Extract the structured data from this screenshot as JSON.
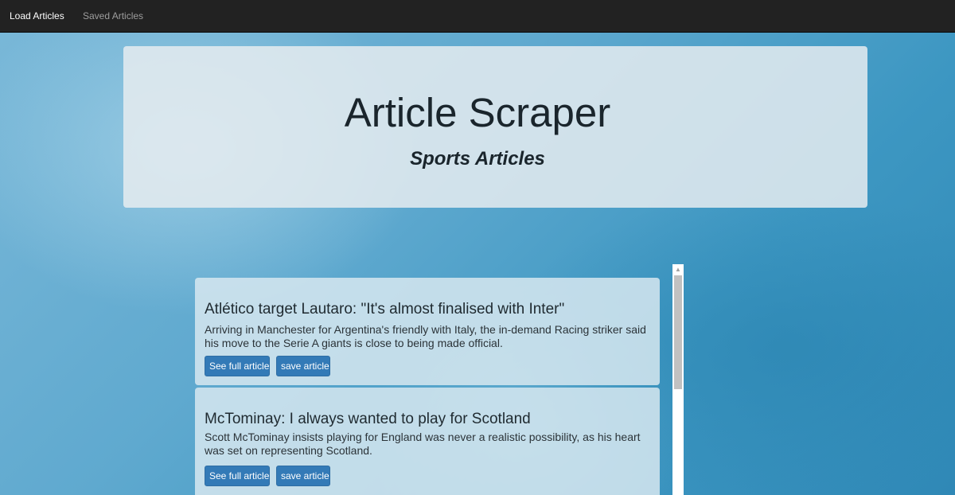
{
  "nav": {
    "load_articles": "Load Articles",
    "saved_articles": "Saved Articles"
  },
  "header": {
    "title": "Article Scraper",
    "subtitle": "Sports Articles"
  },
  "articles": [
    {
      "title": "Atlético target Lautaro: \"It's almost finalised with Inter\"",
      "summary": "Arriving in Manchester for Argentina's friendly with Italy, the in-demand Racing striker said his move to the Serie A giants is close to being made official.",
      "see_full_label": "See full article",
      "save_label": "save article"
    },
    {
      "title": "McTominay: I always wanted to play for Scotland",
      "summary": "Scott McTominay insists playing for England was never a realistic possibility, as his heart was set on representing Scotland.",
      "see_full_label": "See full article",
      "save_label": "save article"
    }
  ],
  "scrollbar": {
    "up_arrow_icon": "triangle-up",
    "position": 0
  },
  "colors": {
    "navbar": "#222222",
    "button": "#337ab7"
  }
}
